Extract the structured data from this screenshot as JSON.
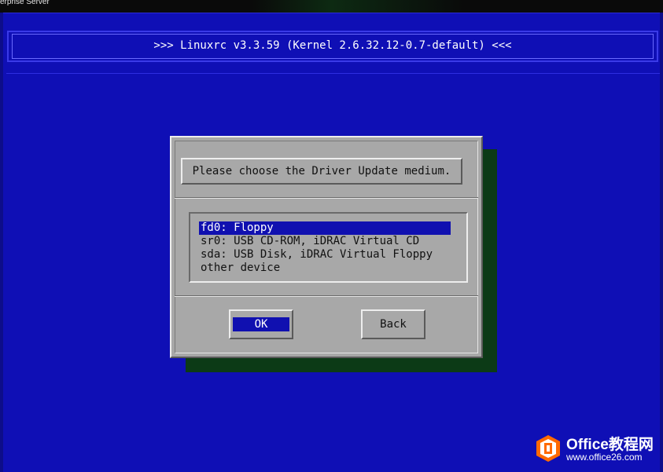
{
  "window": {
    "title": "erprise Server"
  },
  "header": {
    "title": ">>> Linuxrc v3.3.59 (Kernel 2.6.32.12-0.7-default) <<<"
  },
  "dialog": {
    "message": "Please choose the Driver Update medium.",
    "options": [
      {
        "label": "fd0: Floppy",
        "selected": true
      },
      {
        "label": "sr0: USB CD-ROM, iDRAC Virtual CD",
        "selected": false
      },
      {
        "label": "sda: USB Disk, iDRAC Virtual Floppy",
        "selected": false
      },
      {
        "label": "other device",
        "selected": false
      }
    ],
    "buttons": {
      "ok": "OK",
      "back": "Back"
    }
  },
  "watermark": {
    "brand": "Office教程网",
    "url": "www.office26.com"
  },
  "colors": {
    "screen": "#0f0fb5",
    "dialog": "#a8a8a8",
    "selection": "#1010b0",
    "brand_accent": "#ff7a1a"
  }
}
